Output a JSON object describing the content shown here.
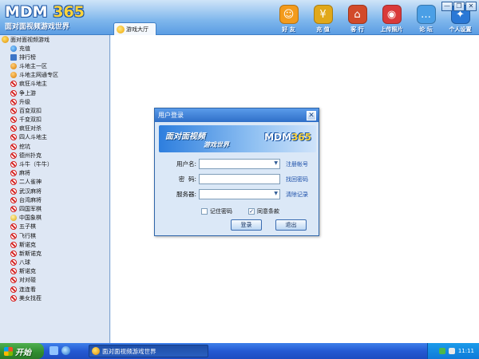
{
  "app": {
    "logo_text": "MDM",
    "logo_number": "365",
    "logo_subtitle": "面对面视频游戏世界"
  },
  "tabs": [
    {
      "label": "游戏大厅"
    }
  ],
  "topnav": [
    {
      "label": "好 友",
      "icon": "friends-icon",
      "color": "#f39b1c",
      "glyph": "☺"
    },
    {
      "label": "充 值",
      "icon": "coins-icon",
      "color": "#e1a81a",
      "glyph": "¥"
    },
    {
      "label": "客 行",
      "icon": "house-icon",
      "color": "#d24a2a",
      "glyph": "⌂"
    },
    {
      "label": "上传照片",
      "icon": "camera-icon",
      "color": "#d93a3a",
      "glyph": "◉"
    },
    {
      "label": "论 坛",
      "icon": "chat-icon",
      "color": "#4a9fe6",
      "glyph": "…"
    },
    {
      "label": "个人设置",
      "icon": "user-settings-icon",
      "color": "#2a78d6",
      "glyph": "✦"
    }
  ],
  "window_controls": {
    "minimize": "—",
    "restore": "❐",
    "close": "✕"
  },
  "sidebar": {
    "root": "面对面视频游戏",
    "items": [
      {
        "label": "充值",
        "icon": "ie"
      },
      {
        "label": "排行榜",
        "icon": "list"
      },
      {
        "label": "斗地主一区",
        "icon": "people"
      },
      {
        "label": "斗地主网通专区",
        "icon": "people"
      },
      {
        "label": "疯狂斗地主",
        "icon": "no"
      },
      {
        "label": "争上游",
        "icon": "no"
      },
      {
        "label": "升级",
        "icon": "no"
      },
      {
        "label": "百变双扣",
        "icon": "no"
      },
      {
        "label": "千变双扣",
        "icon": "no"
      },
      {
        "label": "疯狂对杀",
        "icon": "no"
      },
      {
        "label": "四人斗地主",
        "icon": "no"
      },
      {
        "label": "挖坑",
        "icon": "no"
      },
      {
        "label": "德州扑克",
        "icon": "no"
      },
      {
        "label": "斗牛（牛牛）",
        "icon": "no"
      },
      {
        "label": "麻将",
        "icon": "no"
      },
      {
        "label": "二人雀神",
        "icon": "no"
      },
      {
        "label": "武汉麻将",
        "icon": "no"
      },
      {
        "label": "台湾麻将",
        "icon": "no"
      },
      {
        "label": "四国军棋",
        "icon": "no"
      },
      {
        "label": "中国象棋",
        "icon": "chess"
      },
      {
        "label": "五子棋",
        "icon": "no"
      },
      {
        "label": "飞行棋",
        "icon": "no"
      },
      {
        "label": "斯诺克",
        "icon": "no"
      },
      {
        "label": "新斯诺克",
        "icon": "no"
      },
      {
        "label": "八球",
        "icon": "no"
      },
      {
        "label": "斯诺克",
        "icon": "no"
      },
      {
        "label": "对对碰",
        "icon": "no"
      },
      {
        "label": "连连看",
        "icon": "no"
      },
      {
        "label": "美女找茬",
        "icon": "no"
      }
    ]
  },
  "login_dialog": {
    "title": "用户登录",
    "close": "✕",
    "banner_line1": "面对面视频",
    "banner_line2": "游戏世界",
    "banner_logo": "MDM",
    "banner_logo_number": "365",
    "username_label": "用户名:",
    "username_value": "",
    "register_link": "注册帐号",
    "password_label": "密  码:",
    "password_value": "",
    "recover_link": "找回密码",
    "server_label": "服务器:",
    "server_value": "",
    "clear_link": "清除记录",
    "remember_label": "记住密码",
    "remember_checked": false,
    "agree_label": "同意条款",
    "agree_checked": true,
    "login_button": "登录",
    "exit_button": "退出"
  },
  "taskbar": {
    "start_label": "开始",
    "task_label": "面对面视频游戏世界",
    "clock": "11:11"
  }
}
